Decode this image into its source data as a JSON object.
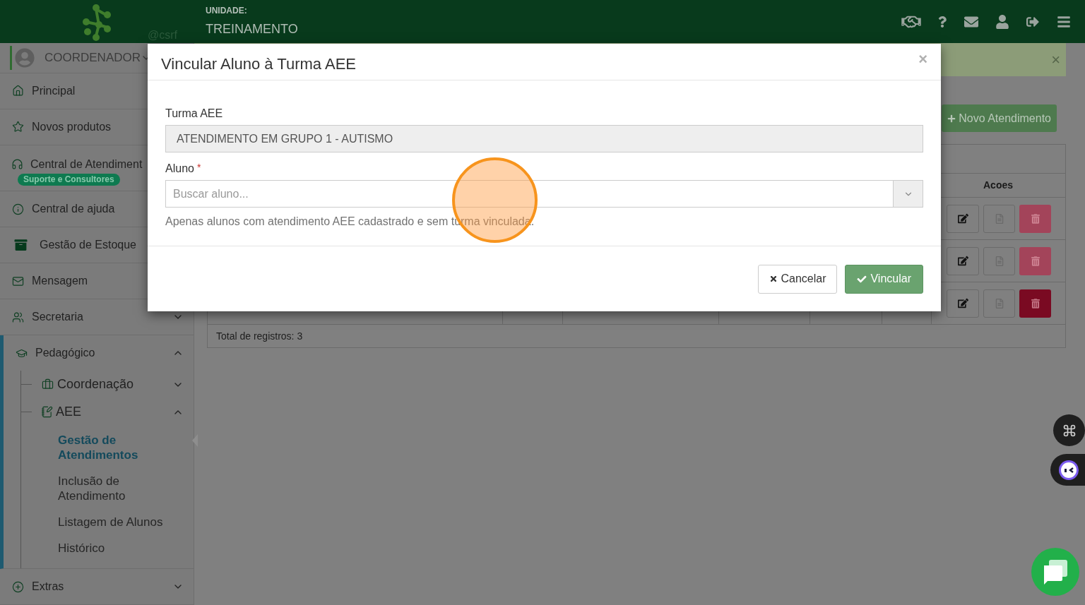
{
  "header": {
    "watermark": "@csrf",
    "unit_label": "UNIDADE:",
    "unit_name": "TREINAMENTO"
  },
  "user": {
    "role": "COORDENADOR"
  },
  "sidebar": {
    "items": [
      {
        "label": "Principal"
      },
      {
        "label": "Novos produtos"
      },
      {
        "label": "Central de Atendiment",
        "badge": "Suporte e Consultores"
      },
      {
        "label": "Central de ajuda"
      },
      {
        "label": "Gestão de Estoque"
      },
      {
        "label": "Mensagem"
      },
      {
        "label": "Secretaria",
        "expanded": false
      },
      {
        "label": "Pedagógico",
        "expanded": true,
        "children": [
          {
            "label": "Coordenação",
            "expanded": false
          },
          {
            "label": "AEE",
            "expanded": true,
            "children": [
              {
                "label": "Gestão de Atendimentos",
                "selected": true
              },
              {
                "label": "Inclusão de Atendimento",
                "selected": false
              },
              {
                "label": "Listagem de Alunos",
                "selected": false
              },
              {
                "label": "Histórico",
                "selected": false
              }
            ]
          }
        ]
      },
      {
        "label": "Extras",
        "expanded": false
      }
    ]
  },
  "alert": {
    "dismiss": "×"
  },
  "new_button": {
    "label": "Novo Atendimento"
  },
  "table": {
    "columns": [
      "Acoes"
    ],
    "rows": [
      {
        "delete_highlighted": false
      },
      {
        "delete_highlighted": false
      },
      {
        "delete_highlighted": true
      }
    ],
    "footer": "Total de registros: 3"
  },
  "modal": {
    "title": "Vincular Aluno à Turma AEE",
    "close": "×",
    "turma": {
      "label": "Turma AEE",
      "value": "ATENDIMENTO EM GRUPO 1 - AUTISMO"
    },
    "aluno": {
      "label": "Aluno",
      "required": true,
      "required_mark": "*",
      "placeholder": "Buscar aluno...",
      "help": "Apenas alunos com atendimento AEE cadastrado e sem turma vinculada."
    },
    "buttons": {
      "cancel": "Cancelar",
      "confirm": "Vincular"
    }
  }
}
